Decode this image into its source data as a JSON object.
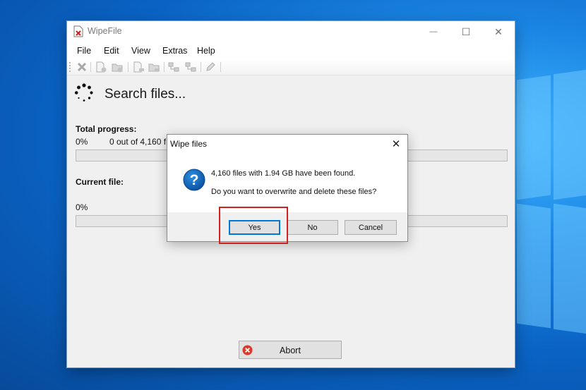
{
  "window": {
    "title": "WipeFile",
    "minimize_glyph": "—",
    "maximize_glyph": "☐",
    "close_glyph": "✕"
  },
  "menu": [
    "File",
    "Edit",
    "View",
    "Extras",
    "Help"
  ],
  "toolbar": {
    "icons": [
      "delete-icon",
      "add-file-icon",
      "add-folder-icon",
      "remove-file-icon",
      "remove-folder-icon",
      "copy-tree-icon",
      "move-tree-icon",
      "edit-icon"
    ]
  },
  "status": {
    "heading": "Search files..."
  },
  "total": {
    "label": "Total progress:",
    "percent": "0%",
    "detail": "0 out of 4,160 fi",
    "progress": 0
  },
  "current": {
    "label": "Current file:",
    "percent": "0%",
    "progress": 0
  },
  "abort": {
    "label": "Abort"
  },
  "dialog": {
    "title": "Wipe files",
    "close_glyph": "✕",
    "line1": "4,160 files with 1.94 GB have been found.",
    "line2": "Do you want to overwrite and delete these files?",
    "yes_label": "Yes",
    "no_label": "No",
    "cancel_label": "Cancel"
  },
  "colors": {
    "accent": "#0078d7",
    "highlight": "#d62020",
    "progress_fill": "#06b025"
  }
}
